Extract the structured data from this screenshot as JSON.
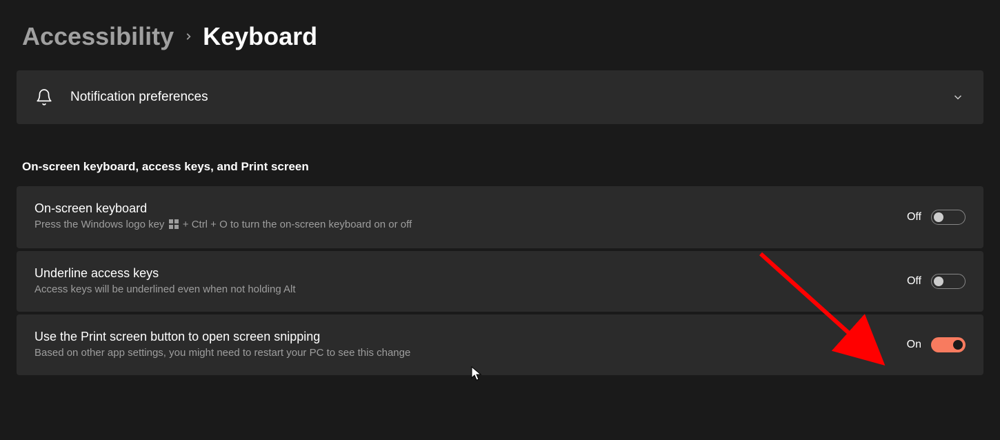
{
  "breadcrumb": {
    "parent": "Accessibility",
    "current": "Keyboard"
  },
  "notification_panel": {
    "title": "Notification preferences"
  },
  "section": {
    "title": "On-screen keyboard, access keys, and Print screen"
  },
  "items": {
    "osk": {
      "title": "On-screen keyboard",
      "desc_pre": "Press the Windows logo key",
      "desc_post": " + Ctrl + O to turn the on-screen keyboard on or off",
      "state": "Off"
    },
    "underline": {
      "title": "Underline access keys",
      "desc": "Access keys will be underlined even when not holding Alt",
      "state": "Off"
    },
    "printscreen": {
      "title": "Use the Print screen button to open screen snipping",
      "desc": "Based on other app settings, you might need to restart your PC to see this change",
      "state": "On"
    }
  },
  "colors": {
    "accent": "#f87b5f",
    "annotation": "#ff0000"
  }
}
